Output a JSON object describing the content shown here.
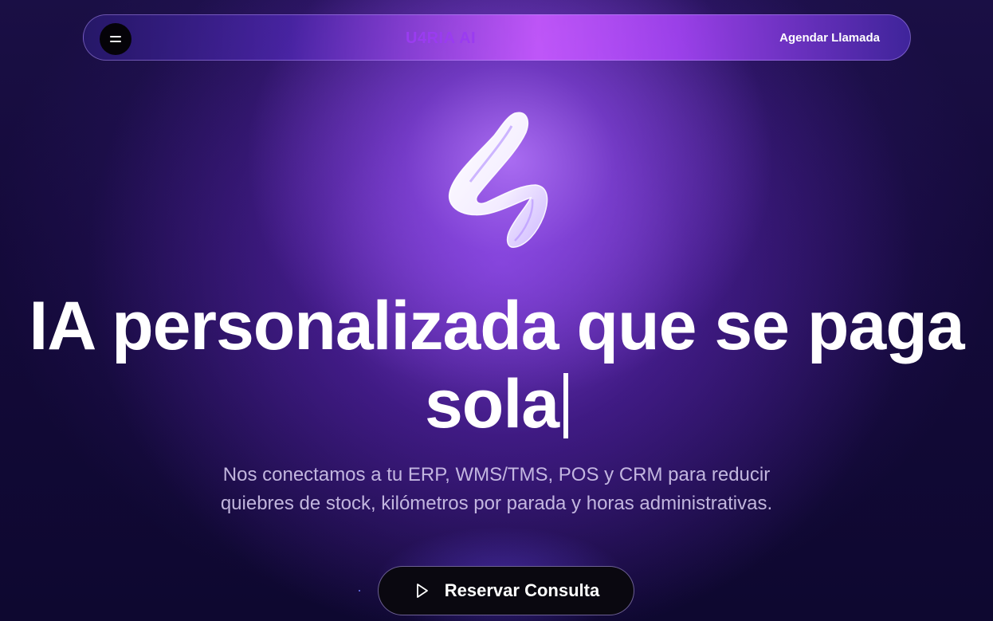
{
  "nav": {
    "menu_icon": "menu-icon",
    "brand": "U4RIA AI",
    "cta": "Agendar Llamada"
  },
  "hero": {
    "logo_icon": "u4ria-logo-mark",
    "headline_line1": "IA personalizada que se paga",
    "headline_line2": "sola",
    "subtitle_line1": "Nos conectamos a tu ERP, WMS/TMS, POS y CRM para reducir",
    "subtitle_line2": "quiebres de stock, kilómetros por parada y horas administrativas.",
    "button_label": "Reservar Consulta",
    "button_icon": "play-icon"
  },
  "colors": {
    "brand_text": "#9a3cf0",
    "accent_glow": "#b878ff",
    "background": "#140a3a"
  }
}
